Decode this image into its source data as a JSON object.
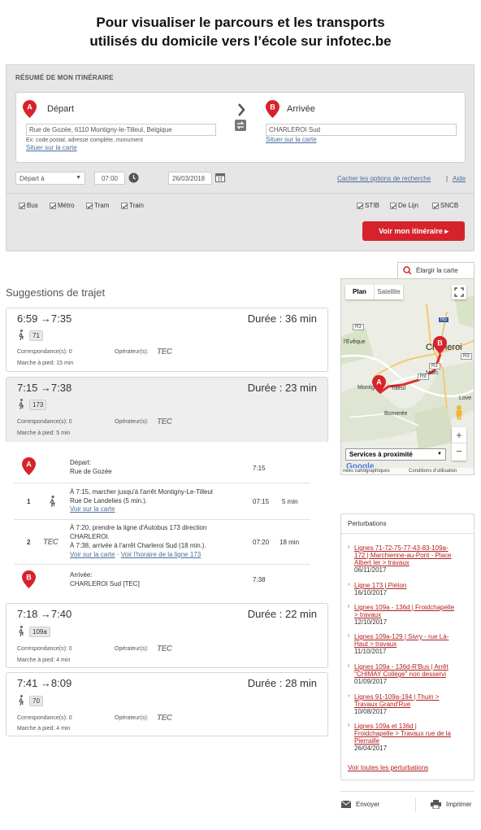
{
  "headline": {
    "line1": "Pour visualiser le parcours et les transports",
    "line2": "utilisés du domicile vers l’école sur infotec.be"
  },
  "form": {
    "title": "RÉSUMÉ DE MON ITINÉRAIRE",
    "depart_pin": "A",
    "depart_label": "Départ",
    "depart_value": "Rue de Gozée, 6110 Montigny-le-Tilleul, Belgique",
    "depart_hint": "Ex: code postal, adresse complète, monument",
    "depart_map_link": "Situer sur la carte",
    "arrivee_pin": "B",
    "arrivee_label": "Arrivée",
    "arrivee_value": "CHARLEROI Sud",
    "arrivee_map_link": "Situer sur la carte",
    "mode": "Départ à",
    "time": "07:00",
    "date": "26/03/2018",
    "hide_options": "Cacher les options de recherche",
    "separator": "|",
    "help": "Aide",
    "modes": [
      "Bus",
      "Métro",
      "Tram",
      "Train"
    ],
    "operators": [
      "STIB",
      "De Lijn",
      "SNCB"
    ],
    "submit": "Voir mon itinéraire ▸"
  },
  "map": {
    "enlarge": "Élargir la carte",
    "tab_plan": "Plan",
    "tab_sat": "Satellite",
    "places": {
      "charleroi": "Charleroi",
      "montigny": "Montig",
      "tilleul": "Tilleul",
      "leveque": "l'Évêque",
      "bomeree": "Bomerée",
      "marchienne": "Marc",
      "love": "Love"
    },
    "roads": [
      "N5",
      "R3",
      "R9",
      "R3",
      "R3"
    ],
    "services": "Services à proximité",
    "zoom_in": "+",
    "zoom_out": "−",
    "google": "Google",
    "footer_left": "nées cartographiques",
    "footer_right": "Conditions d'utilisation"
  },
  "suggestions": {
    "title": "Suggestions de trajet",
    "routes": [
      {
        "times": "6:59 →7:35",
        "duration": "Durée : 36 min",
        "line": "71",
        "correspondances": "Correspondance(s): 0",
        "operateur": "Opérateur(s):",
        "operator_logo": "TEC",
        "marche": "Marche à pied: 15 min"
      },
      {
        "times": "7:15 →7:38",
        "duration": "Durée : 23 min",
        "line": "173",
        "correspondances": "Correspondance(s): 0",
        "operateur": "Opérateur(s):",
        "operator_logo": "TEC",
        "marche": "Marche à pied: 5 min"
      },
      {
        "times": "7:18 →7:40",
        "duration": "Durée : 22 min",
        "line": "109a",
        "correspondances": "Correspondance(s): 0",
        "operateur": "Opérateur(s):",
        "operator_logo": "TEC",
        "marche": "Marche à pied: 4 min"
      },
      {
        "times": "7:41 →8:09",
        "duration": "Durée : 28 min",
        "line": "70",
        "correspondances": "Correspondance(s): 0",
        "operateur": "Opérateur(s):",
        "operator_logo": "TEC",
        "marche": "Marche à pied: 4 min"
      }
    ],
    "detail": {
      "start_pin": "A",
      "start_label": "Départ:",
      "start_place": "Rue de Gozée",
      "start_time": "7:15",
      "step1_num": "1",
      "step1_l1": "À 7:15, marcher jusqu'à l'arrêt Montigny-Le-Tilleul",
      "step1_l2": "Rue De Landelies (5 min.).",
      "step1_link": "Voir sur la carte",
      "step1_time": "07:15",
      "step1_dur": "5 min",
      "step2_num": "2",
      "step2_logo": "TEC",
      "step2_l1": "À 7:20, prendre la ligne d'Autobus 173 direction",
      "step2_l2": "CHARLEROI.",
      "step2_l3": "À 7:38, arrivée à l'arrêt Charleroi Sud (18 min.).",
      "step2_link1": "Voir sur la carte",
      "step2_sep": "·",
      "step2_link2": "Voir l'horaire de la ligne 173",
      "step2_time": "07:20",
      "step2_dur": "18 min",
      "end_pin": "B",
      "end_label": "Arrivée:",
      "end_place": "CHARLEROI Sud [TEC]",
      "end_time": "7:38"
    }
  },
  "perturbations": {
    "title": "Perturbations",
    "items": [
      {
        "l1": "Lignes 71-72-75-77-43-83-109a-",
        "l2": "172 | Marchienne-au-Pont - Place",
        "l3": "Albert Ier > travaux",
        "date": "06/11/2017"
      },
      {
        "l1": "Ligne 173 | Piéton",
        "l2": "",
        "l3": "",
        "date": "16/10/2017"
      },
      {
        "l1": "Lignes 109a - 136d | Froidchapelle",
        "l2": "> travaux",
        "l3": "",
        "date": "12/10/2017"
      },
      {
        "l1": "Lignes 109a-129 | Sivry - rue Là-",
        "l2": "Haut > travaux",
        "l3": "",
        "date": "11/10/2017"
      },
      {
        "l1": "Lignes 109a - 136d-R'Bus | Arrêt",
        "l2": "\"CHIMAY Collège\" non desservi",
        "l3": "",
        "date": "01/09/2017"
      },
      {
        "l1": "Lignes 91-109a-194 | Thuin >",
        "l2": "Travaux Grand'Rue",
        "l3": "",
        "date": "10/08/2017"
      },
      {
        "l1": "Lignes 109a et 136d |",
        "l2": "Froidchapelle > Travaux rue de la",
        "l3": "Pierraille",
        "date": "26/04/2017"
      }
    ],
    "all_link": "Voir toutes les perturbations"
  },
  "footer": {
    "send": "Envoyer",
    "print": "Imprimer"
  },
  "colors": {
    "accent_red": "#d6232b",
    "link_blue": "#4a6e99",
    "link_red": "#b22020"
  }
}
